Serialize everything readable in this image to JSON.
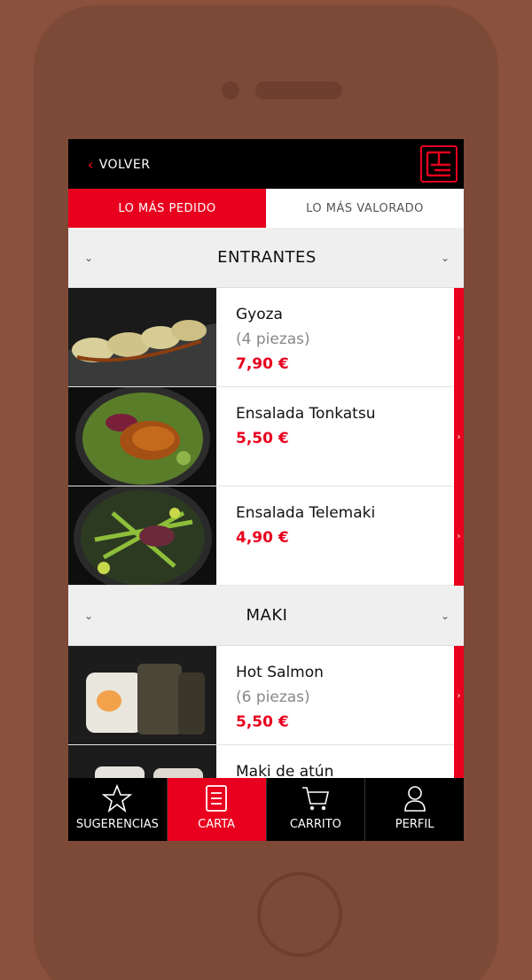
{
  "header": {
    "back_label": "VOLVER"
  },
  "tabs": [
    {
      "label": "LO MÁS PEDIDO",
      "active": true
    },
    {
      "label": "LO MÁS VALORADO",
      "active": false
    }
  ],
  "sections": [
    {
      "title": "ENTRANTES",
      "items": [
        {
          "name": "Gyoza",
          "sub": "(4 piezas)",
          "price": "7,90 €"
        },
        {
          "name": "Ensalada Tonkatsu",
          "price": "5,50 €"
        },
        {
          "name": "Ensalada Telemaki",
          "price": "4,90 €"
        }
      ]
    },
    {
      "title": "MAKI",
      "items": [
        {
          "name": "Hot Salmon",
          "sub": "(6 piezas)",
          "price": "5,50 €"
        },
        {
          "name": "Maki de atún"
        }
      ]
    }
  ],
  "nav": [
    {
      "label": "SUGERENCIAS",
      "icon": "star-icon"
    },
    {
      "label": "CARTA",
      "icon": "menu-list-icon",
      "active": true
    },
    {
      "label": "CARRITO",
      "icon": "cart-icon"
    },
    {
      "label": "PERFIL",
      "icon": "user-icon"
    }
  ],
  "colors": {
    "accent": "#e8001e",
    "background": "#8a513d",
    "bar": "#000000"
  }
}
